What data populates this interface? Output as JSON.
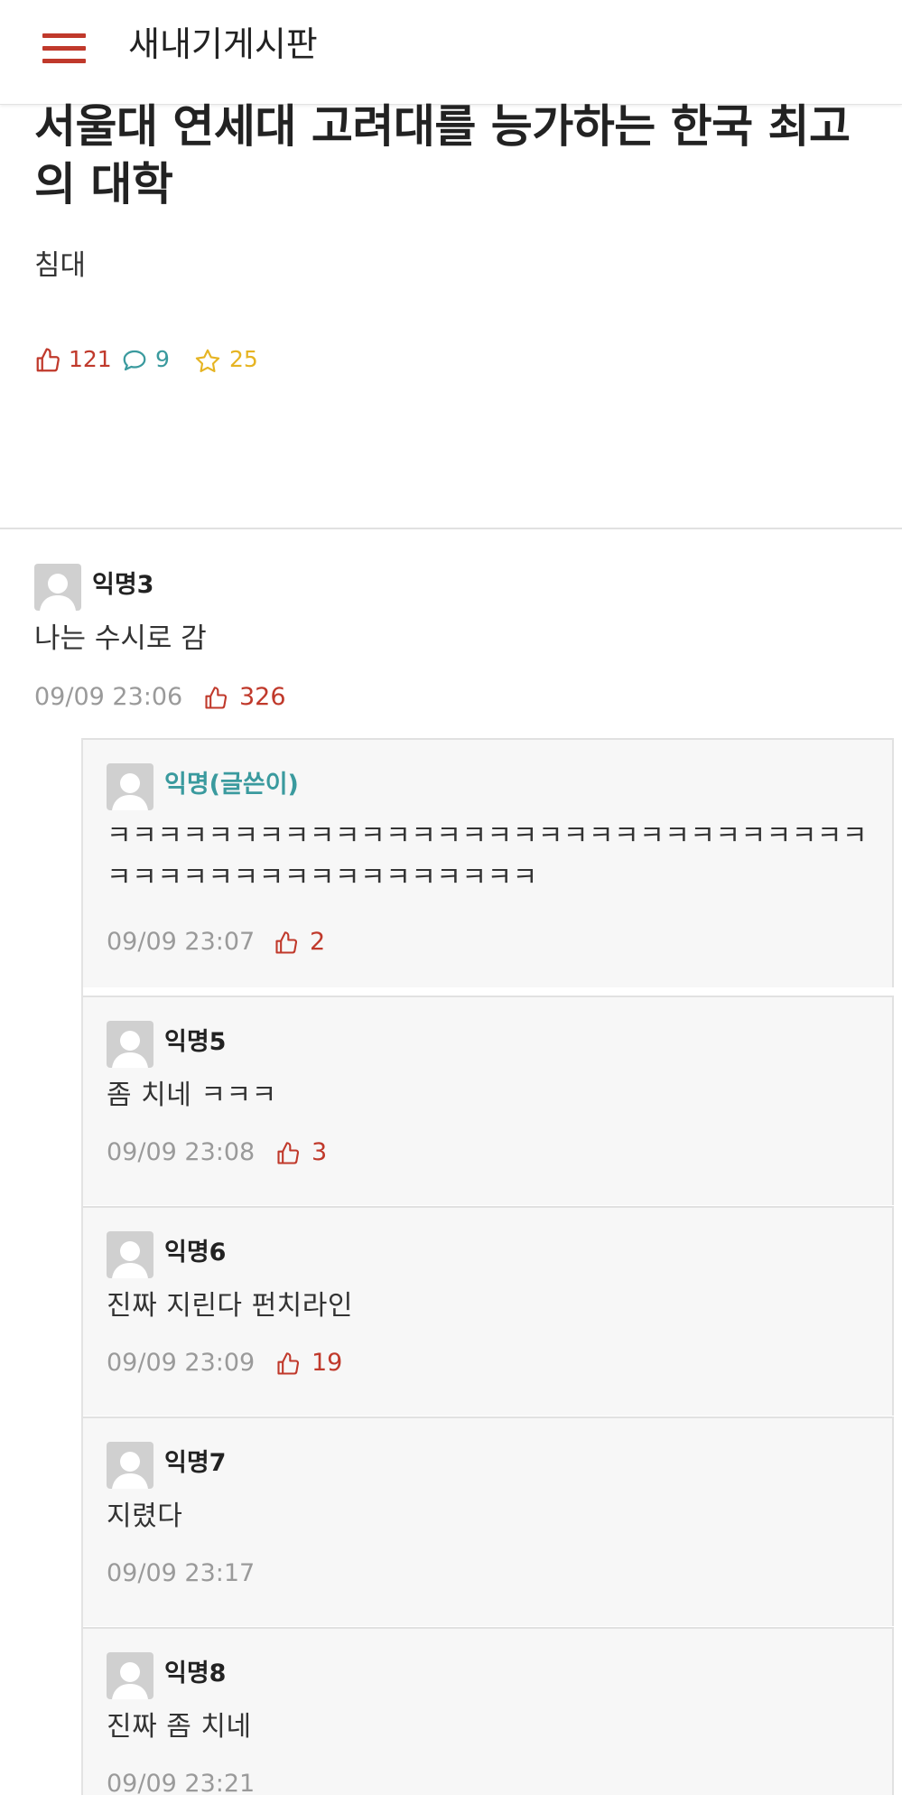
{
  "header": {
    "title": "새내기게시판",
    "menu_icon": "hamburger-menu-icon",
    "accent_color": "#c0392b"
  },
  "post": {
    "title": "서울대 연세대 고려대를 능가하는 한국 최고의 대학",
    "body": "침대",
    "stats": {
      "likes": "121",
      "comments": "9",
      "scraps": "25",
      "likes_color": "#c0392b",
      "comments_color": "#3a9a9e",
      "scraps_color": "#e6b422"
    }
  },
  "comments": [
    {
      "author": "익명3",
      "text": "나는 수시로 감",
      "time": "09/09 23:06",
      "likes": "326",
      "replies": [
        {
          "author": "익명(글쓴이)",
          "is_op": true,
          "text": "ㅋㅋㅋㅋㅋㅋㅋㅋㅋㅋㅋㅋㅋㅋㅋㅋㅋㅋㅋㅋㅋㅋㅋㅋㅋㅋㅋㅋㅋㅋㅋㅋㅋㅋㅋㅋㅋㅋㅋㅋㅋㅋㅋㅋㅋㅋㅋ",
          "time": "09/09 23:07",
          "likes": "2"
        },
        {
          "author": "익명5",
          "text": "좀 치네 ㅋㅋㅋ",
          "time": "09/09 23:08",
          "likes": "3"
        },
        {
          "author": "익명6",
          "text": "진짜 지린다 펀치라인",
          "time": "09/09 23:09",
          "likes": "19"
        },
        {
          "author": "익명7",
          "text": "지렸다",
          "time": "09/09 23:17",
          "likes": null
        },
        {
          "author": "익명8",
          "text": "진짜 좀 치네",
          "time": "09/09 23:21",
          "likes": null
        }
      ]
    }
  ]
}
